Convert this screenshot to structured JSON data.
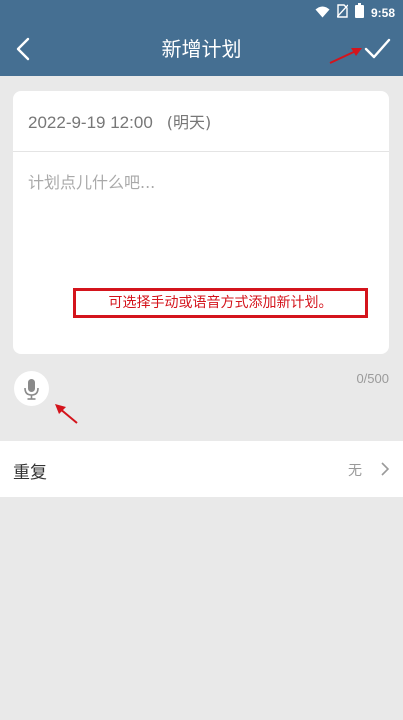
{
  "status_bar": {
    "time": "9:58"
  },
  "header": {
    "title": "新增计划"
  },
  "plan_card": {
    "datetime": "2022-9-19 12:00",
    "relative_day": "(明天)",
    "input_placeholder": "计划点儿什么吧...",
    "annotation": "可选择手动或语音方式添加新计划。"
  },
  "char_counter": "0/500",
  "repeat": {
    "label": "重复",
    "value": "无"
  },
  "colors": {
    "header_bg": "#456f92",
    "page_bg": "#e9e9e9",
    "annotation_red": "#d4141c"
  }
}
